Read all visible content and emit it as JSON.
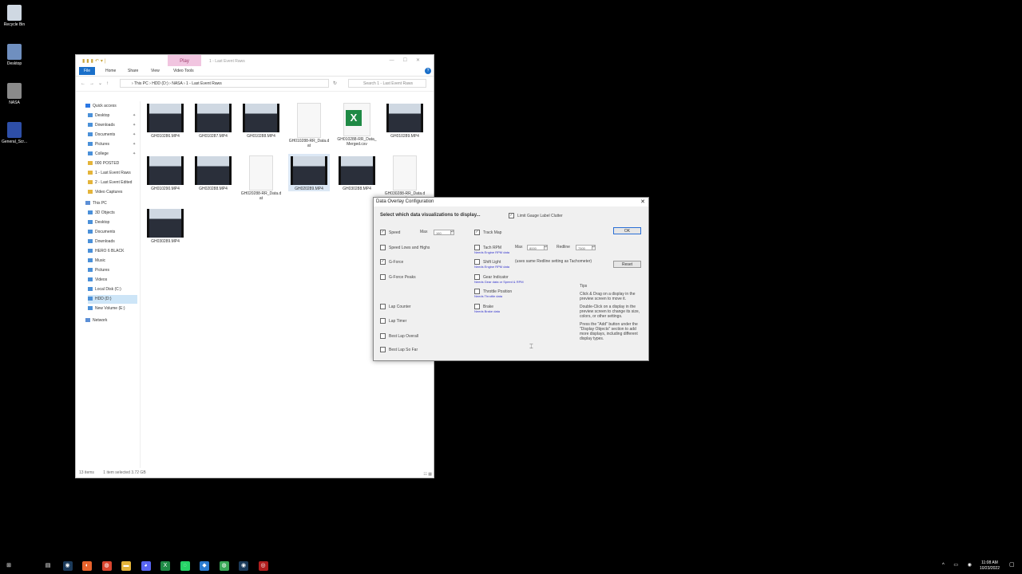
{
  "desktop": {
    "icons": [
      {
        "label": "Recycle Bin",
        "icon": "recycle-bin-icon",
        "color": "#cfd8e2"
      },
      {
        "label": "Desktop",
        "icon": "shortcut-icon",
        "color": "#6f8fbf"
      },
      {
        "label": "NASA",
        "icon": "shortcut-icon",
        "color": "#8a8a8a"
      },
      {
        "label": "General_Scr...",
        "icon": "app-icon",
        "color": "#2e4fa8"
      }
    ]
  },
  "explorer": {
    "context_tab": "Play",
    "title": "1 - Last Event Raws",
    "ribbon": [
      "File",
      "Home",
      "Share",
      "View",
      "Video Tools"
    ],
    "address": [
      "This PC",
      "HDD (D:)",
      "NASA",
      "1 - Last Event Raws"
    ],
    "search_placeholder": "Search 1 - Last Event Raws",
    "sidebar": [
      "Quick access",
      "Desktop",
      "Downloads",
      "Documents",
      "Pictures",
      "College",
      "000 POSTED",
      "1 - Last Event Raws",
      "2 - Last Event Edited",
      "Video Captures",
      "This PC",
      "3D Objects",
      "Desktop",
      "Documents",
      "Downloads",
      "HERO 6 BLACK",
      "Music",
      "Pictures",
      "Videos",
      "Local Disk (C:)",
      "HDD (D:)",
      "New Volume (E:)",
      "Network"
    ],
    "files": [
      {
        "name": "GH010286.MP4",
        "kind": "video"
      },
      {
        "name": "GH010287.MP4",
        "kind": "video"
      },
      {
        "name": "GH010288.MP4",
        "kind": "video"
      },
      {
        "name": "GH010288-RR_Data.dat",
        "kind": "dat"
      },
      {
        "name": "GH010288-RR_Data_Merged.csv",
        "kind": "excel"
      },
      {
        "name": "GH010289.MP4",
        "kind": "video"
      },
      {
        "name": "GH010290.MP4",
        "kind": "video"
      },
      {
        "name": "GH020288.MP4",
        "kind": "video"
      },
      {
        "name": "GH020288-RR_Data.dat",
        "kind": "dat"
      },
      {
        "name": "GH020289.MP4",
        "kind": "video"
      },
      {
        "name": "GH030288.MP4",
        "kind": "video"
      },
      {
        "name": "GH030288-RR_Data.dat",
        "kind": "dat"
      },
      {
        "name": "GH030289.MP4",
        "kind": "video"
      }
    ],
    "status": {
      "count": "13 items",
      "selected": "1 item selected  3.72 GB"
    }
  },
  "dialog": {
    "title": "Data Overlay Configuration",
    "heading": "Select which data visualizations to display...",
    "limit_label": "Limit Gauge Label Clutter",
    "left_options": [
      {
        "label": "Speed",
        "checked": true
      },
      {
        "label": "Speed Lows and Highs",
        "checked": false
      },
      {
        "label": "G-Force",
        "checked": true
      },
      {
        "label": "G-Force Peaks",
        "checked": false
      },
      {
        "label": "Lap Counter",
        "checked": false
      },
      {
        "label": "Lap Timer",
        "checked": false
      },
      {
        "label": "Best Lap Overall",
        "checked": false
      },
      {
        "label": "Best Lap So Far",
        "checked": false
      }
    ],
    "speed_max_label": "Max",
    "speed_max_value": "160",
    "right_options": [
      {
        "label": "Track Map",
        "checked": true,
        "note": ""
      },
      {
        "label": "Tach RPM",
        "checked": false,
        "note": "Needs Engine RPM data"
      },
      {
        "label": "Shift Light",
        "checked": false,
        "note": "Needs Engine RPM data"
      },
      {
        "label": "Gear Indicator",
        "checked": false,
        "note": "Needs Gear data or Speed & RPM"
      },
      {
        "label": "Throttle Position",
        "checked": false,
        "note": "Needs Throttle data"
      },
      {
        "label": "Brake",
        "checked": false,
        "note": "Needs Brake data"
      }
    ],
    "rpm_max_label": "Max",
    "rpm_max_value": "8000",
    "redline_label": "Redline",
    "redline_value": "7500",
    "shift_hint": "(uses same Redline setting as Tachometer)",
    "ok_label": "OK",
    "reset_label": "Reset",
    "tips_title": "Tips",
    "tips": [
      "Click & Drag on a display in the preview screen to move it.",
      "Double-Click on a display in the preview screen to change its size, colors, or other settings.",
      "Press the \"Add\" button under the \"Display Objects\" section to add more displays, including different display types."
    ]
  },
  "taskbar": {
    "apps": [
      {
        "icon": "windows-start-icon",
        "color": "#2b78e4"
      },
      {
        "icon": "search-icon",
        "color": "#333"
      },
      {
        "icon": "task-view-icon",
        "color": "#333"
      },
      {
        "icon": "steam-icon",
        "color": "#1b3a5a"
      },
      {
        "icon": "firefox-icon",
        "color": "#e8632c"
      },
      {
        "icon": "chrome-icon",
        "color": "#d9452f"
      },
      {
        "icon": "file-explorer-icon",
        "color": "#e4b43a"
      },
      {
        "icon": "discord-icon",
        "color": "#5865f2"
      },
      {
        "icon": "excel-icon",
        "color": "#1f8a45"
      },
      {
        "icon": "whatsapp-icon",
        "color": "#25d366"
      },
      {
        "icon": "vscode-icon",
        "color": "#2b7bd1"
      },
      {
        "icon": "chrome-icon",
        "color": "#3aa757"
      },
      {
        "icon": "steam-icon",
        "color": "#1b3a5a"
      },
      {
        "icon": "race-render-icon",
        "color": "#b01e1e"
      }
    ],
    "time": "11:08 AM",
    "date": "10/23/2022"
  }
}
